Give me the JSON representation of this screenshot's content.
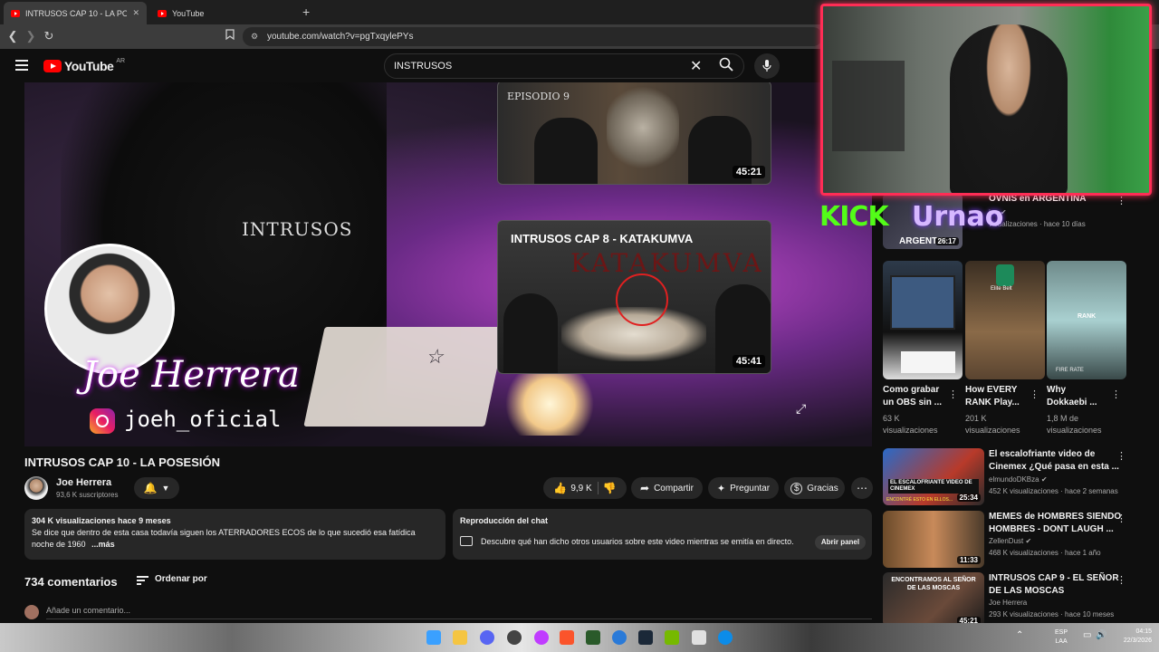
{
  "browser": {
    "tabs": [
      {
        "label": "INTRUSOS CAP 10 - LA POSESIÓ",
        "active": true
      },
      {
        "label": "YouTube",
        "active": false
      }
    ],
    "new_tab": "+",
    "close_tab": "✕",
    "url": "youtube.com/watch?v=pgTxqylePYs"
  },
  "header": {
    "logo_text": "YouTube",
    "region": "AR",
    "search_query": "INSTRUSOS"
  },
  "player": {
    "channel_overlay": "Joe Herrera",
    "instagram_handle": "joeh_oficial",
    "logo_word": "INTRUSOS",
    "end_cards": [
      {
        "episode_label": "EPISODIO 9",
        "duration": "45:21"
      },
      {
        "title": "INTRUSOS CAP 8 - KATAKUMVA",
        "bg_text": "KATAKUMVA",
        "duration": "45:41"
      }
    ]
  },
  "video": {
    "title": "INTRUSOS CAP 10 - LA POSESIÓN",
    "channel": "Joe Herrera",
    "subscribers": "93,6 K suscriptores",
    "likes": "9,9 K",
    "share": "Compartir",
    "ask": "Preguntar",
    "thanks": "Gracias"
  },
  "description": {
    "stats": "304 K visualizaciones  hace 9 meses",
    "line1": "Se dice que dentro de esta casa todavía siguen los ATERRADORES ECOS de lo que sucedió esa fatídica",
    "line2": "noche de 1960",
    "more": "...más"
  },
  "chat_replay": {
    "title": "Reproducción del chat",
    "text": "Descubre qué han dicho otros usuarios sobre este video mientras se emitía en directo.",
    "button": "Abrir panel"
  },
  "comments": {
    "count": "734 comentarios",
    "sort": "Ordenar por",
    "placeholder": "Añade un comentario..."
  },
  "stream_overlay": {
    "kick": "KICK",
    "name": "Urnao",
    "sub": "ARGENTINA"
  },
  "sidebar": {
    "top_item": {
      "title": "OVNIS en ARGENTINA",
      "channel": "ion",
      "meta": "visualizaciones · hace 10 días",
      "duration": "26:17",
      "thumb_text": "ARGENTIN"
    },
    "shorts": [
      {
        "title1": "Como grabar",
        "title2": "un OBS sin ...",
        "views1": "63 K",
        "views2": "visualizaciones",
        "thumb_text": ""
      },
      {
        "title1": "How EVERY",
        "title2": "RANK Play...",
        "views1": "201 K",
        "views2": "visualizaciones",
        "thumb_text": "Elite Belt"
      },
      {
        "title1": "Why",
        "title2": "Dokkaebi ...",
        "views1": "1,8 M de",
        "views2": "visualizaciones",
        "thumb_text": "RANK",
        "thumb_text2": "FIRE RATE"
      }
    ],
    "videos": [
      {
        "title1": "El escalofriante video de",
        "title2": "Cinemex ¿Qué pasa en esta ...",
        "channel": "elmundoDKBza",
        "meta": "452 K visualizaciones · hace 2 semanas",
        "duration": "25:34",
        "thumb_text": "EL ESCALOFRIANTE VIDEO DE CINEMEX",
        "thumb_sub": "ENCONTRÉ ESTO EN ELLOS..."
      },
      {
        "title1": "MEMES de HOMBRES SIENDO",
        "title2": "HOMBRES - DONT LAUGH ...",
        "channel": "ZellenDust",
        "meta": "468 K visualizaciones · hace 1 año",
        "duration": "11:33"
      },
      {
        "title1": "INTRUSOS CAP 9 - EL SEÑOR",
        "title2": "DE LAS MOSCAS",
        "channel": "Joe Herrera",
        "meta": "293 K visualizaciones · hace 10 meses",
        "duration": "45:21",
        "thumb_text": "ENCONTRAMOS AL SEÑOR DE LAS MOSCAS"
      }
    ]
  },
  "taskbar": {
    "lang1": "ESP",
    "lang2": "LAA",
    "time": "04:15",
    "date": "22/3/2026"
  },
  "colors": {
    "accent": "#ff0000",
    "cam_border": "#ff2d55",
    "kick_green": "#53fc18"
  }
}
